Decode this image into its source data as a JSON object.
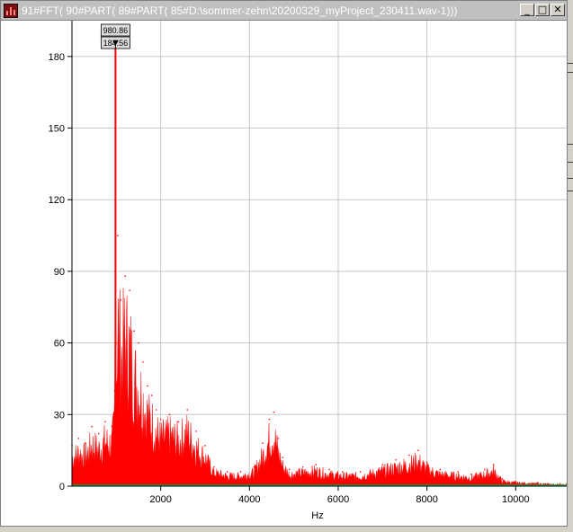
{
  "window": {
    "title": "91#FFT( 90#PART( 89#PART( 85#D:\\sommer-zehn\\20200329_myProject_230411.wav-1)))",
    "buttons": [
      {
        "name": "minimize-button",
        "label": "_"
      },
      {
        "name": "maximize-button",
        "label": "□"
      },
      {
        "name": "close-button",
        "label": "✕"
      }
    ]
  },
  "chart_data": {
    "type": "area",
    "title": "",
    "xlabel": "Hz",
    "ylabel": "",
    "xlim": [
      0,
      11150
    ],
    "ylim": [
      0,
      195
    ],
    "x_ticks": [
      2000,
      4000,
      6000,
      8000,
      10000
    ],
    "y_ticks": [
      0,
      30,
      60,
      90,
      120,
      150,
      180
    ],
    "grid": true,
    "series": [
      {
        "color": "#ff0000",
        "x": [
          0,
          150,
          300,
          450,
          600,
          750,
          900,
          960,
          980.86,
          1000,
          1030,
          1100,
          1200,
          1300,
          1400,
          1500,
          1600,
          1700,
          1800,
          1900,
          2000,
          2200,
          2400,
          2600,
          2800,
          3000,
          3200,
          3500,
          3800,
          4100,
          4300,
          4450,
          4550,
          4650,
          4750,
          4900,
          5200,
          5500,
          5800,
          6100,
          6500,
          7000,
          7300,
          7600,
          7800,
          8000,
          8300,
          8700,
          9000,
          9300,
          9500,
          9700,
          10000,
          10500,
          11000,
          11150
        ],
        "values": [
          17,
          20,
          18,
          25,
          22,
          27,
          25,
          40,
          184.56,
          60,
          105,
          78,
          88,
          82,
          65,
          60,
          52,
          42,
          38,
          32,
          28,
          30,
          27,
          32,
          23,
          17,
          8,
          6,
          6,
          8,
          18,
          28,
          31,
          20,
          12,
          7,
          8,
          9,
          7,
          6,
          6,
          9,
          11,
          13,
          15,
          10,
          7,
          6,
          5,
          7,
          9,
          3,
          2,
          1.5,
          1,
          1
        ]
      }
    ],
    "baseline_color": "#00b050",
    "marker": {
      "x": "980.86",
      "y": "184.56"
    }
  }
}
